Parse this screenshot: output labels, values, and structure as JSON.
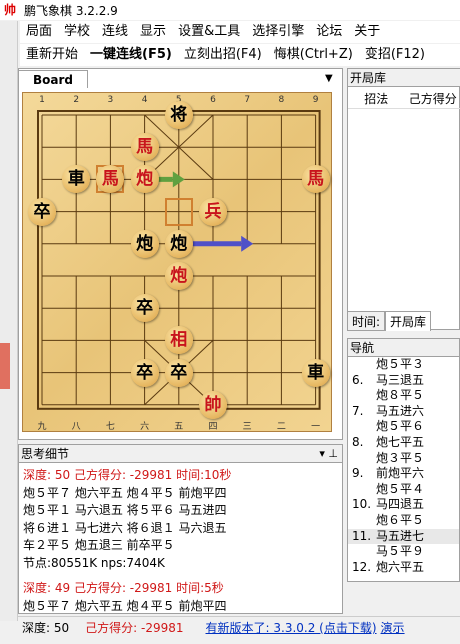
{
  "window": {
    "title": "鹏飞象棋 3.2.2.9",
    "icon_char": "帅"
  },
  "menu": [
    "局面",
    "学校",
    "连线",
    "显示",
    "设置&工具",
    "选择引擎",
    "论坛",
    "关于"
  ],
  "toolbar": [
    {
      "label": "重新开始",
      "bold": false
    },
    {
      "label": "一键连线(F5)",
      "bold": true
    },
    {
      "label": "立刻出招(F4)",
      "bold": false
    },
    {
      "label": "悔棋(Ctrl+Z)",
      "bold": false
    },
    {
      "label": "变招(F12)",
      "bold": false
    }
  ],
  "board_tab": "Board",
  "board": {
    "top_files": [
      "1",
      "2",
      "3",
      "4",
      "5",
      "6",
      "7",
      "8",
      "9"
    ],
    "bottom_files": [
      "九",
      "八",
      "七",
      "六",
      "五",
      "四",
      "三",
      "二",
      "一"
    ],
    "pieces": [
      {
        "char": "将",
        "color": "black",
        "file": 4,
        "rank": 0
      },
      {
        "char": "馬",
        "color": "red",
        "file": 3,
        "rank": 1
      },
      {
        "char": "車",
        "color": "black",
        "file": 1,
        "rank": 2
      },
      {
        "char": "馬",
        "color": "red",
        "file": 2,
        "rank": 2
      },
      {
        "char": "炮",
        "color": "red",
        "file": 3,
        "rank": 2
      },
      {
        "char": "馬",
        "color": "red",
        "file": 8,
        "rank": 2
      },
      {
        "char": "卒",
        "color": "black",
        "file": 0,
        "rank": 3
      },
      {
        "char": "兵",
        "color": "red",
        "file": 5,
        "rank": 3
      },
      {
        "char": "炮",
        "color": "black",
        "file": 3,
        "rank": 4
      },
      {
        "char": "炮",
        "color": "black",
        "file": 4,
        "rank": 4
      },
      {
        "char": "炮",
        "color": "red",
        "file": 4,
        "rank": 5
      },
      {
        "char": "卒",
        "color": "black",
        "file": 3,
        "rank": 6
      },
      {
        "char": "相",
        "color": "red",
        "file": 4,
        "rank": 7
      },
      {
        "char": "卒",
        "color": "black",
        "file": 3,
        "rank": 8
      },
      {
        "char": "卒",
        "color": "black",
        "file": 4,
        "rank": 8
      },
      {
        "char": "車",
        "color": "black",
        "file": 8,
        "rank": 8
      },
      {
        "char": "帥",
        "color": "red",
        "file": 5,
        "rank": 9
      }
    ]
  },
  "opening_panel": {
    "title": "开局库",
    "col1": "招法",
    "col2": "己方得分"
  },
  "right_tabs": [
    "时间:",
    "开局库"
  ],
  "nav": {
    "title": "导航",
    "rows": [
      {
        "num": "",
        "move": "炮５平３"
      },
      {
        "num": "6.",
        "move": "马三退五"
      },
      {
        "num": "",
        "move": "炮８平５"
      },
      {
        "num": "7.",
        "move": "马五进六"
      },
      {
        "num": "",
        "move": "炮５平６"
      },
      {
        "num": "8.",
        "move": "炮七平五"
      },
      {
        "num": "",
        "move": "炮３平５"
      },
      {
        "num": "9.",
        "move": "前炮平六"
      },
      {
        "num": "",
        "move": "炮５平４"
      },
      {
        "num": "10.",
        "move": "马四退五"
      },
      {
        "num": "",
        "move": "炮６平５"
      },
      {
        "num": "11.",
        "move": "马五进七"
      },
      {
        "num": "",
        "move": "马５平９"
      },
      {
        "num": "12.",
        "move": "炮六平五"
      }
    ]
  },
  "think": {
    "title": "思考细节",
    "pin": "▾ ⊥",
    "blocks": [
      {
        "header": "深度: 50 己方得分: -29981 时间:10秒",
        "lines": [
          "炮５平７  炮六平五  炮４平５  前炮平四",
          "炮５平１  马六退五  将５平６  马五进四",
          "将６进１  马七进六  将６退１  马六退五",
          "车２平５  炮五退三  前卒平５",
          "节点:80551K nps:7404K"
        ]
      },
      {
        "header": "深度: 49 己方得分: -29981 时间:5秒",
        "lines": [
          "炮５平７  炮六平五  炮４平５  前炮平四"
        ]
      }
    ]
  },
  "status": {
    "depth": "深度: 50",
    "score": "己方得分: -29981",
    "update_link": "有新版本了: 3.3.0.2 (点击下载)",
    "demo_link": "演示"
  }
}
